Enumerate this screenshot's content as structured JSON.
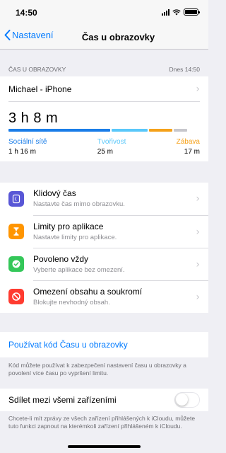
{
  "status_bar": {
    "time": "14:50"
  },
  "nav": {
    "back_label": "Nastavení",
    "title": "Čas u obrazovky"
  },
  "usage": {
    "section_label": "ČAS U OBRAZOVKY",
    "updated": "Dnes 14:50",
    "device": "Michael - iPhone",
    "total": "3 h 8 m",
    "categories": [
      {
        "name": "Sociální sítě",
        "time": "1 h 16 m",
        "color": "#1a7de8",
        "share": 0.53
      },
      {
        "name": "Tvořivost",
        "time": "25 m",
        "color": "#5ac8fa",
        "share": 0.19
      },
      {
        "name": "Zábava",
        "time": "17 m",
        "color": "#f5a11a",
        "share": 0.12
      },
      {
        "name": "",
        "time": "",
        "color": "#c7c7cc",
        "share": 0.07
      }
    ]
  },
  "rows": [
    {
      "icon": "moon-icon",
      "color": "#5856d6",
      "title": "Klidový čas",
      "subtitle": "Nastavte čas mimo obrazovku."
    },
    {
      "icon": "hourglass-icon",
      "color": "#ff9500",
      "title": "Limity pro aplikace",
      "subtitle": "Nastavte limity pro aplikace."
    },
    {
      "icon": "checkmark-icon",
      "color": "#34c759",
      "title": "Povoleno vždy",
      "subtitle": "Vyberte aplikace bez omezení."
    },
    {
      "icon": "no-entry-icon",
      "color": "#ff3b30",
      "title": "Omezení obsahu a soukromí",
      "subtitle": "Blokujte nevhodný obsah."
    }
  ],
  "passcode": {
    "link": "Používat kód Času u obrazovky",
    "footnote": "Kód můžete používat k zabezpečení nastavení času u obrazovky a povolení více času po vypršení limitu."
  },
  "share": {
    "label": "Sdílet mezi všemi zařízeními",
    "enabled": false,
    "footnote": "Chcete-li mít zprávy ze všech zařízení přihlášených k iCloudu, můžete tuto funkci zapnout na kterémkoli zařízení přihlášeném k iCloudu."
  }
}
